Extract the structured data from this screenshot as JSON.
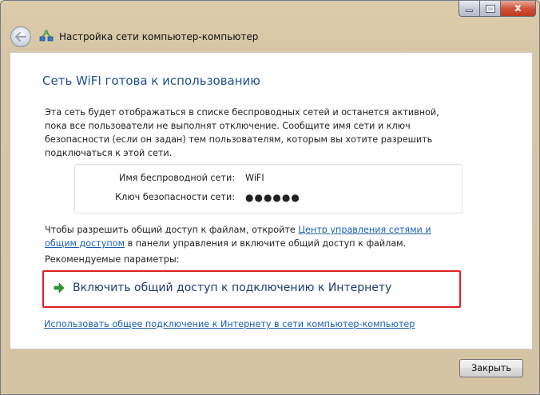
{
  "window": {
    "title": "Настройка сети компьютер-компьютер",
    "controls": {
      "minimize": "",
      "maximize": "",
      "close": "x"
    }
  },
  "content": {
    "heading": "Сеть WiFI готова к использованию",
    "description": "Эта сеть будет отображаться в списке беспроводных сетей и останется активной, пока все пользователи не выполнят отключение. Сообщите имя сети и ключ безопасности (если он задан) тем пользователям, которым вы хотите разрешить подключаться к этой сети.",
    "network_info": {
      "name_label": "Имя беспроводной сети:",
      "name_value": "WiFI",
      "key_label": "Ключ безопасности сети:",
      "key_value": "●●●●●●"
    },
    "share": {
      "text_before": "Чтобы разрешить общий доступ к файлам, откройте ",
      "link_text": "Центр управления сетями и общим доступом",
      "text_after": " в панели управления и включите общий доступ к файлам."
    },
    "recommended_label": "Рекомендуемые параметры:",
    "recommended_option": "Включить общий доступ к подключению к Интернету",
    "adhoc_link": "Использовать общее подключение к Интернету в сети компьютер-компьютер"
  },
  "footer": {
    "close_label": "Закрыть"
  },
  "colors": {
    "heading": "#1e4f8f",
    "link": "#1a5fb4",
    "highlight_border": "#e02020",
    "arrow_green": "#2e9a2e"
  },
  "icons": {
    "back": "back-arrow-icon",
    "wizard": "network-wizard-icon",
    "option": "green-arrow-icon"
  }
}
